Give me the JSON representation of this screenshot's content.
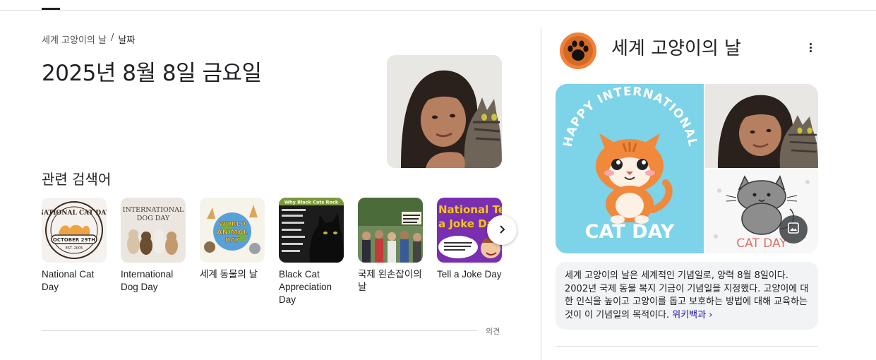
{
  "breadcrumb": {
    "parent": "세계 고양이의 날",
    "separator": "/",
    "current": "날짜"
  },
  "date_title": "2025년 8월 8일 금요일",
  "related": {
    "heading": "관련 검색어",
    "items": [
      {
        "label": "National Cat Day",
        "thumb_text": [
          "NATIONAL CAT DAY",
          "OCTOBER 29TH",
          "EST. 2005"
        ]
      },
      {
        "label": "International Dog Day",
        "thumb_text": [
          "INTERNATIONAL",
          "DOG DAY"
        ]
      },
      {
        "label": "세계 동물의 날",
        "thumb_text": [
          "WORLD",
          "ANIMAL",
          "DAY"
        ]
      },
      {
        "label": "Black Cat Appreciation Day",
        "thumb_text": [
          "Why Black Cats Rock"
        ]
      },
      {
        "label": "국제 왼손잡이의 날",
        "thumb_text": []
      },
      {
        "label": "Tell a Joke Day",
        "thumb_text": [
          "National Tell",
          "a Joke Day"
        ]
      }
    ],
    "next_icon": "chevron-right-icon"
  },
  "feedback_label": "의견",
  "knowledge_panel": {
    "title": "세계 고양이의 날",
    "logo_icon": "paw-icon",
    "more_icon": "more-vert-icon",
    "main_image_text": [
      "HAPPY INTERNATIONAL",
      "CAT DAY"
    ],
    "bottom_right_image_text": "CAT DAY",
    "images_button_icon": "image-icon",
    "description": "세계 고양이의 날은 세계적인 기념일로, 양력 8월 8일이다. 2002년 국제 동물 복지 기금이 기념일을 지정했다. 고양이에 대한 인식을 높이고 고양이를 돕고 보호하는 방법에 대해 교육하는 것이 이 기념일의 목적이다.",
    "wiki_link": "위키백과 ›"
  },
  "colors": {
    "text": "#202124",
    "muted": "#4d5156",
    "link": "#1a0dab",
    "divider": "#dadce0",
    "panel_bg": "#f1f3f4",
    "cat_day_blue": "#7dd3e8",
    "cat_orange": "#f0893c"
  }
}
